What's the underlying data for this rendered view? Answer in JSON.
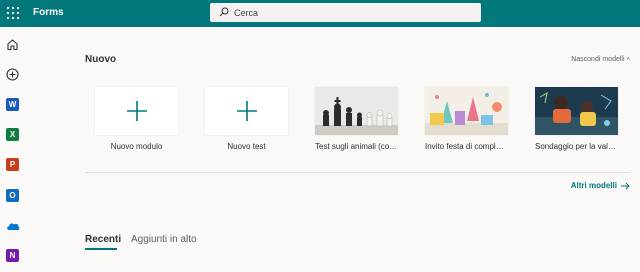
{
  "app": {
    "name": "Forms"
  },
  "search": {
    "placeholder": "Cerca"
  },
  "rail": {
    "items": [
      {
        "icon": "home-icon"
      },
      {
        "icon": "create-icon"
      },
      {
        "icon": "word-icon",
        "letter": "W",
        "color": "#185abd"
      },
      {
        "icon": "excel-icon",
        "letter": "X",
        "color": "#107c41"
      },
      {
        "icon": "powerpoint-icon",
        "letter": "P",
        "color": "#c43e1c"
      },
      {
        "icon": "outlook-icon",
        "letter": "O",
        "color": "#0f6cbd"
      },
      {
        "icon": "onedrive-icon",
        "color": "#0078d4"
      },
      {
        "icon": "onenote-icon",
        "letter": "N",
        "color": "#7719aa"
      }
    ]
  },
  "new_section": {
    "title": "Nuovo",
    "hide_label": "Nascondi modelli",
    "cards": [
      {
        "label": "Nuovo modulo",
        "type": "plus"
      },
      {
        "label": "Nuovo test",
        "type": "plus"
      },
      {
        "label": "Test sugli animali (con val…",
        "type": "chess"
      },
      {
        "label": "Invito festa di compleanno",
        "type": "party"
      },
      {
        "label": "Sondaggio per la valutazio…",
        "type": "kids"
      }
    ],
    "more_label": "Altri modelli"
  },
  "tabs": [
    {
      "label": "Recenti",
      "active": true
    },
    {
      "label": "Aggiunti in alto",
      "active": false
    }
  ],
  "colors": {
    "accent": "#03787c"
  }
}
